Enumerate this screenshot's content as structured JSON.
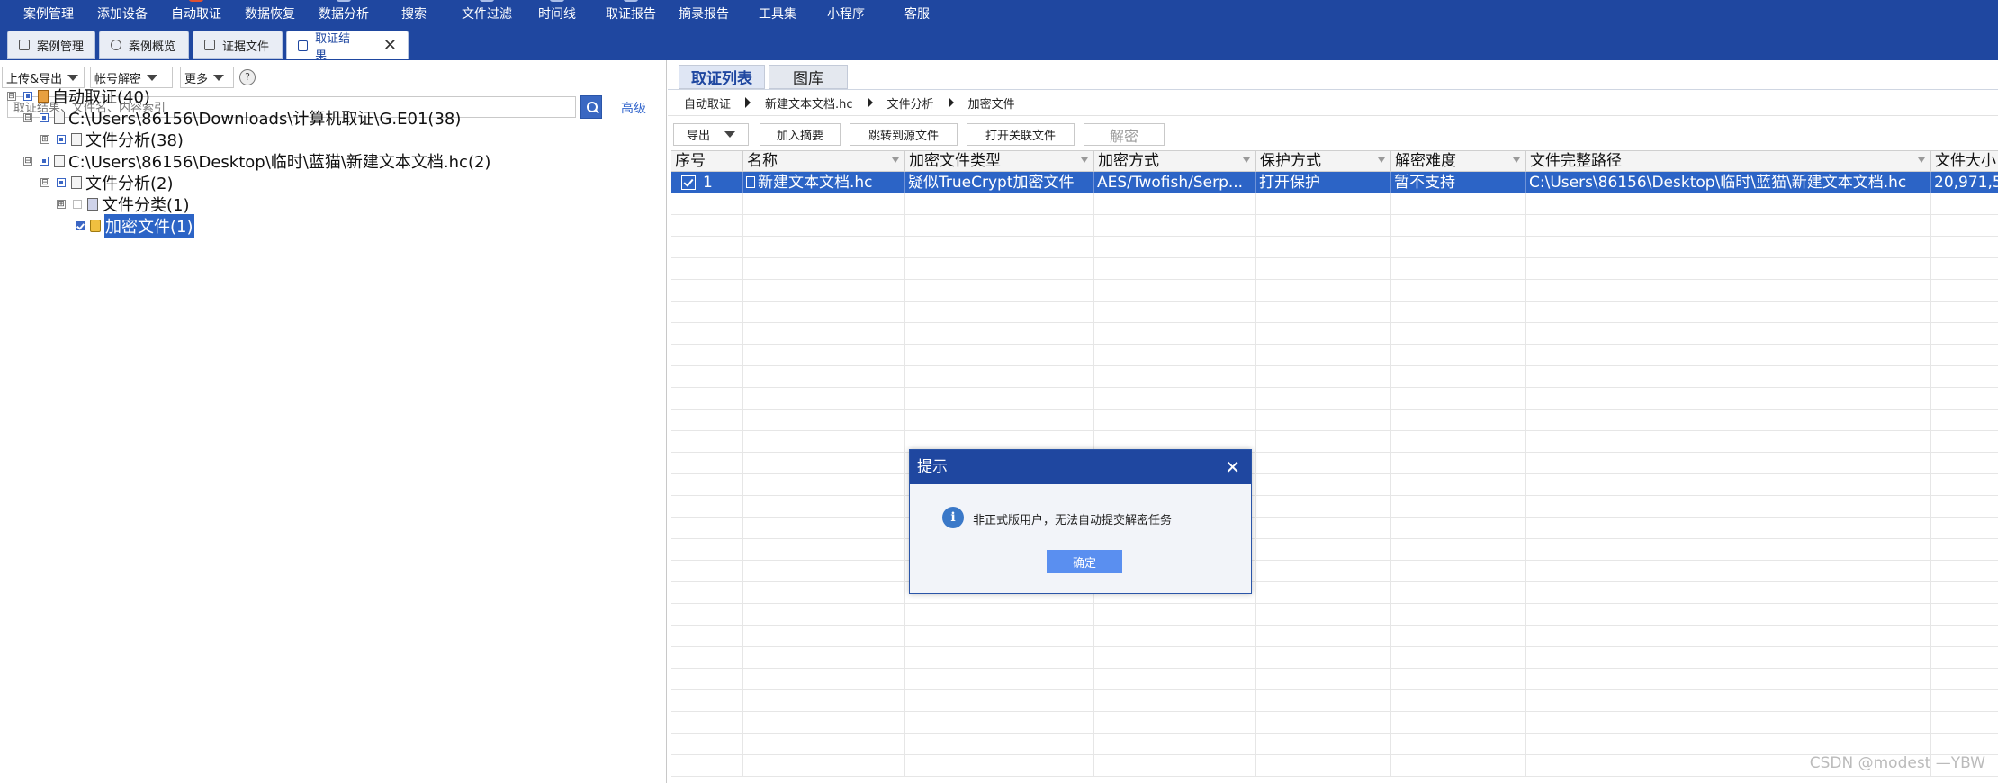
{
  "toolbar": {
    "items": [
      "案例管理",
      "添加设备",
      "自动取证",
      "数据恢复",
      "数据分析",
      "搜索",
      "文件过滤",
      "时间线",
      "取证报告",
      "摘录报告",
      "工具集",
      "小程序",
      "客服"
    ]
  },
  "tabs": [
    {
      "label": "案例管理"
    },
    {
      "label": "案例概览"
    },
    {
      "label": "证据文件"
    },
    {
      "label": "取证结果",
      "close": "✕"
    }
  ],
  "left": {
    "upload_export": "上传&导出",
    "account_decrypt": "帐号解密",
    "more": "更多",
    "help": "?",
    "search_placeholder": "取证结果、文件名、内容索引",
    "advanced": "高级",
    "tree": [
      {
        "label": "自动取证(40)",
        "exp": "⊟"
      },
      {
        "label": "C:\\Users\\86156\\Downloads\\计算机取证\\G.E01(38)",
        "exp": "⊟"
      },
      {
        "label": "文件分析(38)",
        "exp": "⊞"
      },
      {
        "label": "C:\\Users\\86156\\Desktop\\临时\\蓝猫\\新建文本文档.hc(2)",
        "exp": "⊟"
      },
      {
        "label": "文件分析(2)",
        "exp": "⊟"
      },
      {
        "label": "文件分类(1)",
        "exp": "⊞"
      },
      {
        "label": "加密文件(1)"
      }
    ]
  },
  "right": {
    "tabs": [
      "取证列表",
      "图库"
    ],
    "breadcrumb": [
      "自动取证",
      "新建文本文档.hc",
      "文件分析",
      "加密文件"
    ],
    "buttons": {
      "export": "导出",
      "add_summary": "加入摘要",
      "jump_source": "跳转到源文件",
      "open_related": "打开关联文件",
      "decrypt": "解密"
    },
    "columns": [
      "序号",
      "名称",
      "加密文件类型",
      "加密方式",
      "保护方式",
      "解密难度",
      "文件完整路径",
      "文件大小"
    ],
    "rows": [
      {
        "index": "1",
        "name": "新建文本文档.hc",
        "enc_type": "疑似TrueCrypt加密文件",
        "enc_method": "AES/Twofish/Serp...",
        "protection": "打开保护",
        "difficulty": "暂不支持",
        "path": "C:\\Users\\86156\\Desktop\\临时\\蓝猫\\新建文本文档.hc",
        "size": "20,971,5"
      }
    ]
  },
  "modal": {
    "title": "提示",
    "close": "✕",
    "info": "i",
    "message": "非正式版用户，无法自动提交解密任务",
    "ok": "确定"
  },
  "watermark": "CSDN @modest —YBW",
  "colors": {
    "toolbar": "#1f47a0",
    "selection": "#2c64c6",
    "button": "#5a8ff0"
  }
}
